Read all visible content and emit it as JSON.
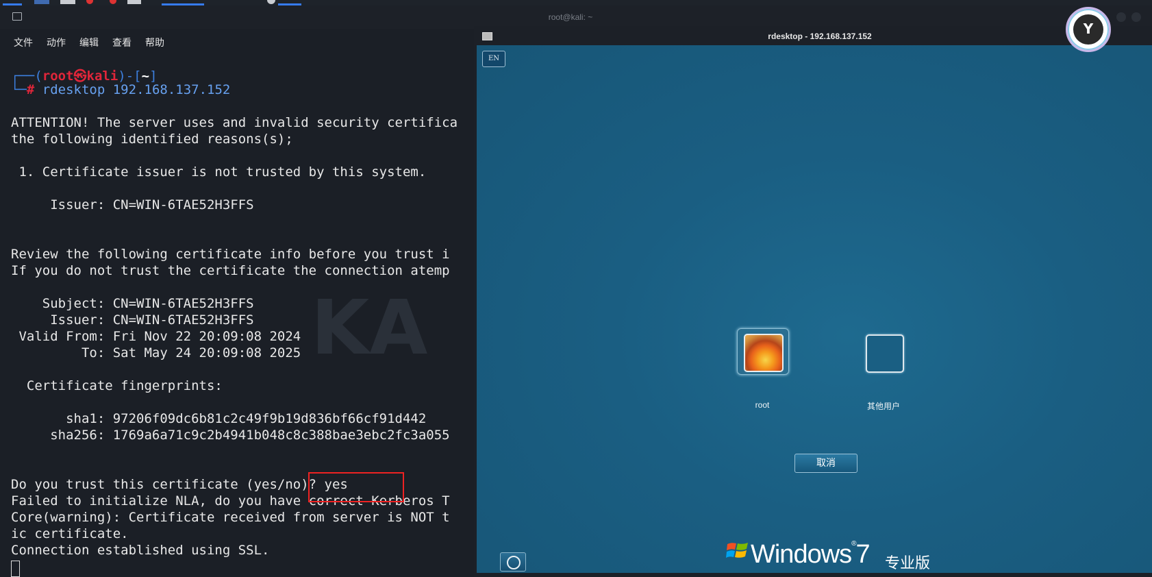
{
  "terminal": {
    "window_title": "root@kali: ~",
    "menu": [
      "文件",
      "动作",
      "编辑",
      "查看",
      "帮助"
    ],
    "prompt_user": "root㉿kali",
    "prompt_dir": "~",
    "command": "rdesktop 192.168.137.152",
    "lines": [
      "ATTENTION! The server uses and invalid security certifica",
      "the following identified reasons(s);",
      " 1. Certificate issuer is not trusted by this system.",
      "     Issuer: CN=WIN-6TAE52H3FFS",
      "Review the following certificate info before you trust i",
      "If you do not trust the certificate the connection atemp",
      "    Subject: CN=WIN-6TAE52H3FFS",
      "     Issuer: CN=WIN-6TAE52H3FFS",
      " Valid From: Fri Nov 22 20:09:08 2024",
      "         To: Sat May 24 20:09:08 2025",
      "  Certificate fingerprints:",
      "       sha1: 97206f09dc6b81c2c49f9b19d836bf66cf91d442",
      "     sha256: 1769a6a71c9c2b4941b048c8c388bae3ebc2fc3a055",
      "Do you trust this certificate (yes/no)? yes",
      "Failed to initialize NLA, do you have correct Kerberos T",
      "Core(warning): Certificate received from server is NOT t",
      "ic certificate.",
      "Connection established using SSL."
    ]
  },
  "rdesktop": {
    "window_title": "rdesktop - 192.168.137.152",
    "lang_indicator": "EN",
    "users": [
      {
        "name": "root"
      },
      {
        "name": "其他用户"
      }
    ],
    "cancel_label": "取消",
    "os_brand": "Windows",
    "os_version": "7",
    "os_edition": "专业版"
  }
}
